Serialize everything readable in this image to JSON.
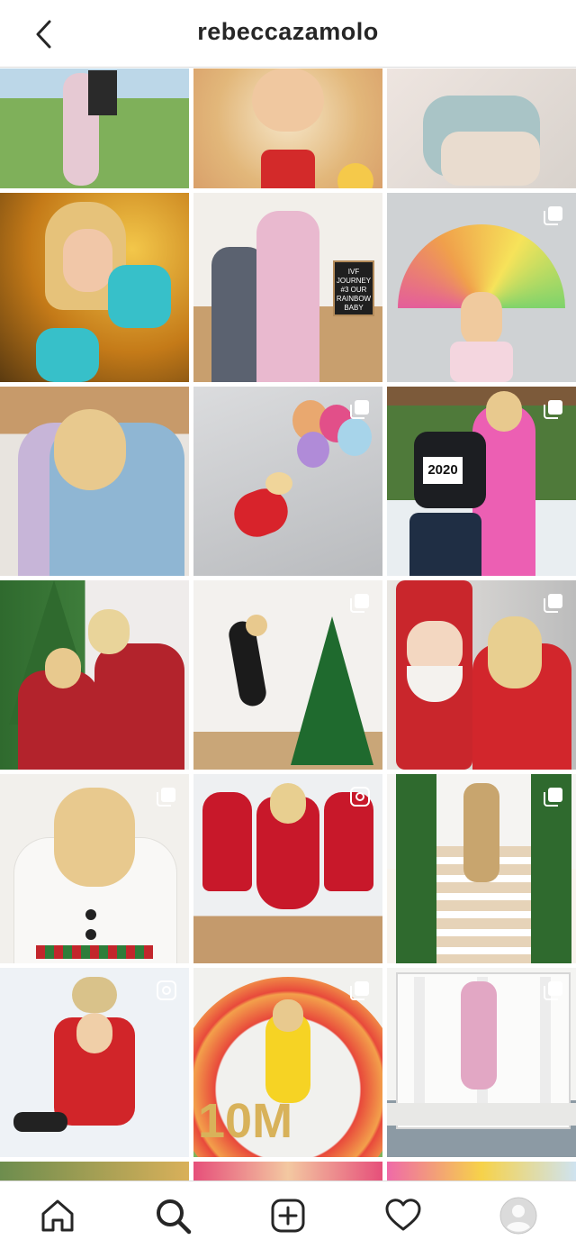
{
  "header": {
    "username": "rebeccazamolo"
  },
  "icons": {
    "back": "chevron-left-icon",
    "home": "home-icon",
    "search": "search-icon",
    "new_post": "plus-square-icon",
    "activity": "heart-icon",
    "profile": "avatar-icon"
  },
  "grid": {
    "post_texts": {
      "sign_1": "IVF JOURNEY #3 OUR RAINBOW BABY",
      "bag_2020": "2020",
      "balloon_10m": "10M"
    }
  },
  "tabs": [
    "home",
    "search",
    "new-post",
    "activity",
    "profile"
  ]
}
